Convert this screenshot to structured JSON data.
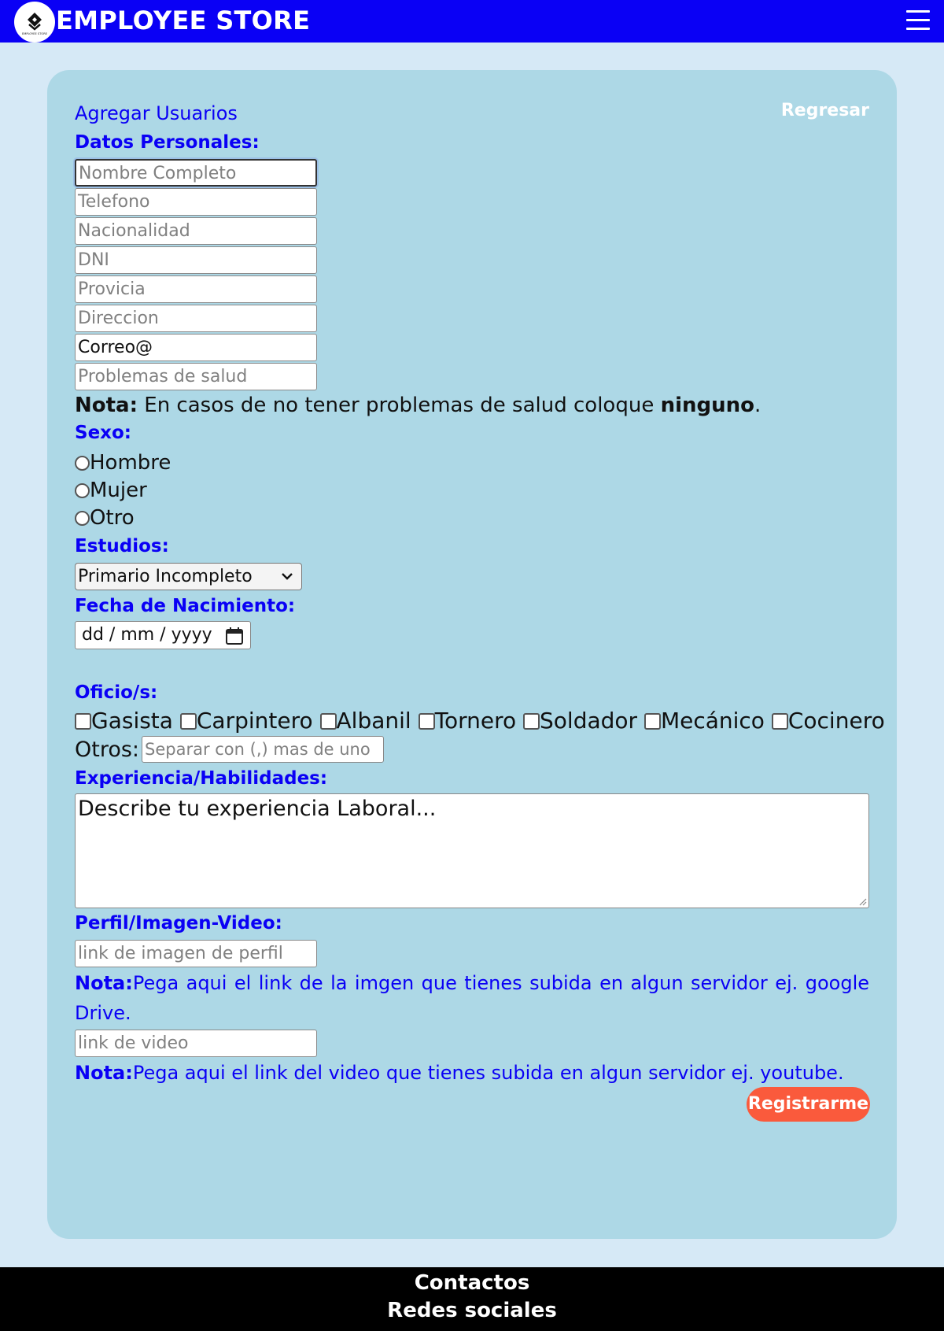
{
  "header": {
    "brand": "EMPLOYEE STORE",
    "logo_text": "EMPLOYEE STORE",
    "menu_icon": "hamburger-icon"
  },
  "form": {
    "title": "Agregar Usuarios",
    "back_label": "Regresar",
    "personal_heading": "Datos Personales:",
    "fields": {
      "nombre": {
        "placeholder": "Nombre Completo",
        "value": ""
      },
      "telefono": {
        "placeholder": "Telefono",
        "value": ""
      },
      "nacionalidad": {
        "placeholder": "Nacionalidad",
        "value": ""
      },
      "dni": {
        "placeholder": "DNI",
        "value": ""
      },
      "provincia": {
        "placeholder": "Provicia",
        "value": ""
      },
      "direccion": {
        "placeholder": "Direccion",
        "value": ""
      },
      "correo": {
        "placeholder": "",
        "value": "Correo@"
      },
      "salud": {
        "placeholder": "Problemas de salud",
        "value": ""
      }
    },
    "health_note": {
      "label": "Nota:",
      "text": " En casos de no tener problemas de salud coloque ",
      "keyword": "ninguno",
      "end": "."
    },
    "sexo_heading": "Sexo:",
    "sexo_options": [
      "Hombre",
      "Mujer",
      "Otro"
    ],
    "estudios_heading": "Estudios:",
    "estudios_selected": "Primario Incompleto",
    "fecha_heading": "Fecha de Nacimiento:",
    "fecha_placeholder": "dd / mm / yyyy",
    "oficios_heading": "Oficio/s:",
    "oficios": [
      "Gasista",
      "Carpintero",
      "Albanil",
      "Tornero",
      "Soldador",
      "Mecánico",
      "Cocinero"
    ],
    "otros_label": "Otros:",
    "otros_placeholder": "Separar con (,) mas de uno",
    "experiencia_heading": "Experiencia/Habilidades:",
    "experiencia_placeholder": "Describe tu experiencia Laboral...",
    "perfil_heading": "Perfil/Imagen-Video:",
    "imagen_placeholder": "link de imagen de perfil",
    "imagen_note": {
      "label": "Nota:",
      "text": "Pega aqui el link de la imgen que tienes subida en algun servidor ej. google Drive."
    },
    "video_placeholder": "link de video",
    "video_note": {
      "label": "Nota:",
      "text": "Pega aqui el link del video que tienes subida en algun servidor ej. youtube."
    },
    "submit_label": "Registrarme"
  },
  "footer": {
    "contactos": "Contactos",
    "redes": "Redes sociales"
  },
  "colors": {
    "header_bg": "#0a00f5",
    "page_bg": "#d6e9f6",
    "card_bg": "#add8e6",
    "accent_blue": "#0a00f5",
    "submit_bg": "#fa5a3c",
    "footer_bg": "#000000"
  }
}
